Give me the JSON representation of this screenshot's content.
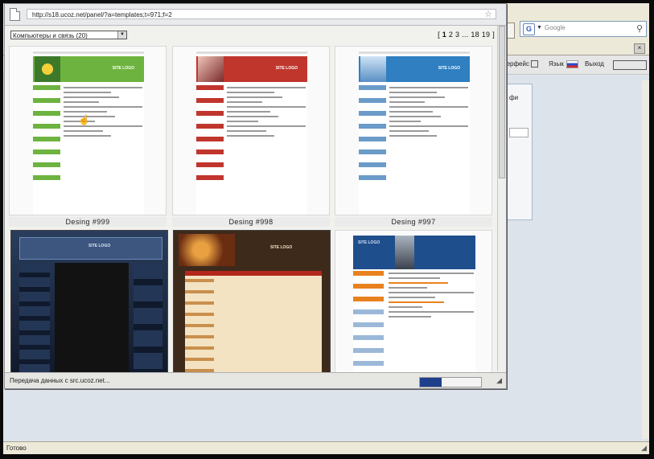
{
  "background_window": {
    "search_placeholder": "Google",
    "search_engine_letter": "G",
    "back_glyph": "◄",
    "nav": {
      "interface_label": "терфейс",
      "language_label": "Язык",
      "logout_label": "Выход"
    },
    "panel_text": "фи",
    "status_text": "Готово"
  },
  "popup": {
    "url": "http://s18.ucoz.net/panel/?a=templates;t=971;f=2",
    "category_select": "Компьютеры и связь (20)",
    "pager": {
      "current": "1",
      "pages": [
        "2",
        "3"
      ],
      "ellipsis": "...",
      "tail": [
        "18",
        "19"
      ],
      "open": "[",
      "close": "]"
    },
    "templates": [
      {
        "caption": "Desing #999",
        "accent": "#6db33f",
        "logo": "SITE LOGO"
      },
      {
        "caption": "Desing #998",
        "accent": "#c0362c",
        "logo": "SITE LOGO"
      },
      {
        "caption": "Desing #997",
        "accent": "#2f7fc1",
        "logo": "SITE LOGO"
      },
      {
        "caption": "",
        "accent": "#1e3a6a",
        "logo": "SITE LOGO"
      },
      {
        "caption": "",
        "accent": "#6b4a2a",
        "logo": "SITE LOGO"
      },
      {
        "caption": "",
        "accent": "#1f4e8c",
        "logo": "SITE LOGO"
      }
    ],
    "status_text": "Передача данных с src.ucoz.net...",
    "progress": 0.35
  }
}
